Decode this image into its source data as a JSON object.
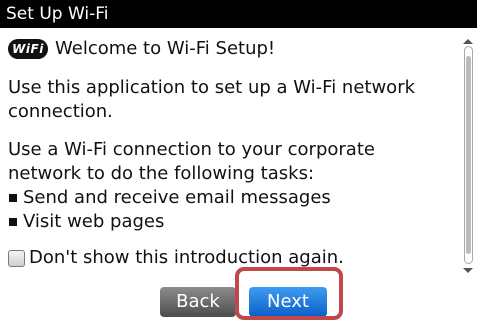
{
  "title_bar": {
    "title": "Set Up Wi-Fi"
  },
  "content": {
    "logo_text": "WiFi",
    "welcome": "Welcome to Wi-Fi Setup!",
    "intro": "Use this application to set up a Wi-Fi network connection.",
    "tasks_intro": "Use a Wi-Fi connection to your corporate network to do the following tasks:",
    "tasks": [
      "Send and receive email messages",
      "Visit web pages"
    ],
    "checkbox_label": "Don't show this introduction again.",
    "checkbox_checked": false
  },
  "buttons": {
    "back": "Back",
    "next": "Next"
  },
  "colors": {
    "title_bar": "#000000",
    "next_button": "#1a73d6",
    "highlight": "#c1484a"
  }
}
